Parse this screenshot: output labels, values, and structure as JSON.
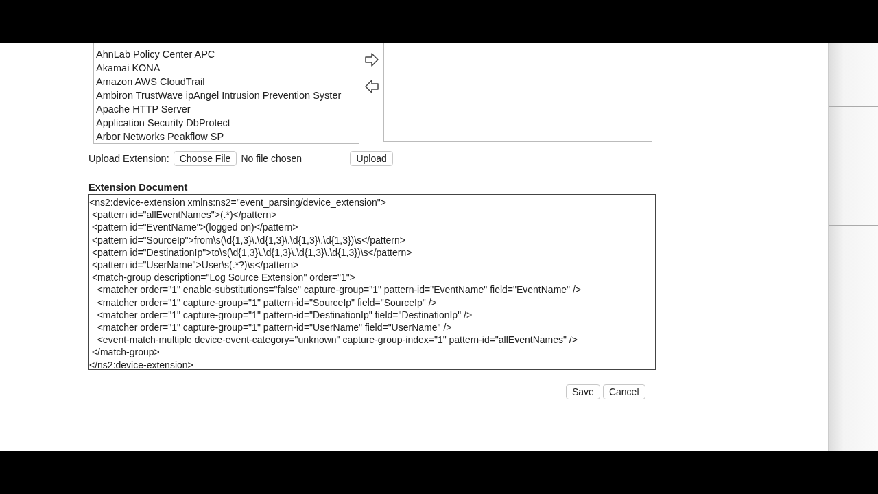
{
  "available_list": {
    "items": [
      "AhnLab Policy Center APC",
      "Akamai KONA",
      "Amazon AWS CloudTrail",
      "Ambiron TrustWave ipAngel Intrusion Prevention Syster",
      "Apache HTTP Server",
      "Application Security DbProtect",
      "Arbor Networks Peakflow SP"
    ]
  },
  "upload": {
    "label": "Upload Extension:",
    "choose_button": "Choose File",
    "file_status": "No file chosen",
    "upload_button": "Upload"
  },
  "document": {
    "heading": "Extension Document",
    "lines": [
      "<ns2:device-extension xmlns:ns2=\"event_parsing/device_extension\">",
      " <pattern id=\"allEventNames\">(.*)</pattern>",
      " <pattern id=\"EventName\">(logged on)</pattern>",
      " <pattern id=\"SourceIp\">from\\s(\\d{1,3}\\.\\d{1,3}\\.\\d{1,3}\\.\\d{1,3})\\s</pattern>",
      " <pattern id=\"DestinationIp\">to\\s(\\d{1,3}\\.\\d{1,3}\\.\\d{1,3}\\.\\d{1,3})\\s</pattern>",
      " <pattern id=\"UserName\">User\\s(.*?)\\s</pattern>",
      " <match-group description=\"Log Source Extension\" order=\"1\">",
      "   <matcher order=\"1\" enable-substitutions=\"false\" capture-group=\"1\" pattern-id=\"EventName\" field=\"EventName\" />",
      "   <matcher order=\"1\" capture-group=\"1\" pattern-id=\"SourceIp\" field=\"SourceIp\" />",
      "   <matcher order=\"1\" capture-group=\"1\" pattern-id=\"DestinationIp\" field=\"DestinationIp\" />",
      "   <matcher order=\"1\" capture-group=\"1\" pattern-id=\"UserName\" field=\"UserName\" />",
      "   <event-match-multiple device-event-category=\"unknown\" capture-group-index=\"1\" pattern-id=\"allEventNames\" />",
      " </match-group>",
      "</ns2:device-extension>"
    ]
  },
  "actions": [
    "Save",
    "Cancel"
  ]
}
